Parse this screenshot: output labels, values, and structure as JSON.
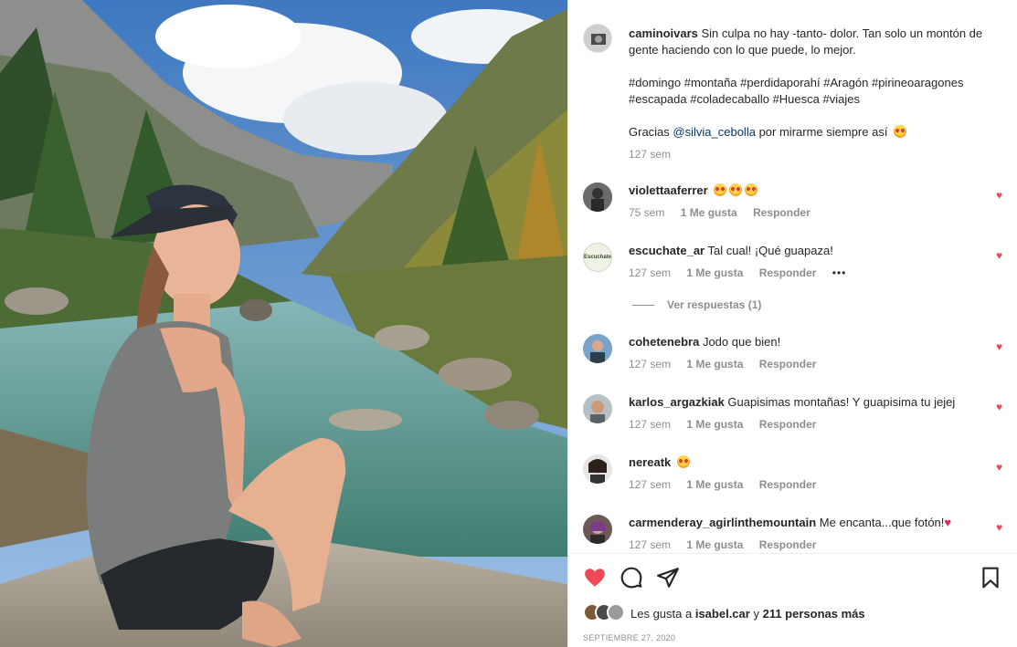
{
  "caption": {
    "username": "caminoivars",
    "text": "Sin culpa no hay -tanto- dolor. Tan solo un montón de gente haciendo con lo que puede, lo mejor.",
    "hashtags_line1": "#domingo #montaña #perdidaporahí #Aragón #pirineoaragones",
    "hashtags_line2": "#escapada #coladecaballo #Huesca #viajes",
    "thanks_pre": "Gracias",
    "mention": "@silvia_cebolla",
    "thanks_post": "por mirarme siempre así",
    "time": "127 sem"
  },
  "comments": [
    {
      "username": "violettaaferrer",
      "text": "",
      "time": "75 sem",
      "likes": "1 Me gusta",
      "reply": "Responder"
    },
    {
      "username": "escuchate_ar",
      "text": "Tal cual! ¡Qué guapaza!",
      "time": "127 sem",
      "likes": "1 Me gusta",
      "reply": "Responder",
      "more": "•••",
      "avatar_text": "Escuchate"
    },
    {
      "username": "cohetenebra",
      "text": "Jodo que bien!",
      "time": "127 sem",
      "likes": "1 Me gusta",
      "reply": "Responder"
    },
    {
      "username": "karlos_argazkiak",
      "text": "Guapisimas montañas! Y guapisima tu jejej",
      "time": "127 sem",
      "likes": "1 Me gusta",
      "reply": "Responder"
    },
    {
      "username": "nereatk",
      "text": "",
      "time": "127 sem",
      "likes": "1 Me gusta",
      "reply": "Responder"
    },
    {
      "username": "carmenderay_agirlinthemountain",
      "text": "Me encanta...que fotón!",
      "time": "127 sem",
      "likes": "1 Me gusta",
      "reply": "Responder"
    }
  ],
  "view_replies": "Ver respuestas (1)",
  "likes": {
    "prefix": "Les gusta a",
    "user": "isabel.car",
    "middle": "y",
    "others": "211 personas más"
  },
  "date": "SEPTIEMBRE 27, 2020",
  "icons": {
    "like": "heart-filled-icon",
    "comment": "comment-bubble-icon",
    "share": "paper-plane-icon",
    "save": "bookmark-icon",
    "comment_like": "small-heart-icon"
  },
  "colors": {
    "like_red": "#ed4956",
    "link_blue": "#00376b",
    "meta_gray": "#8e8e8e"
  }
}
